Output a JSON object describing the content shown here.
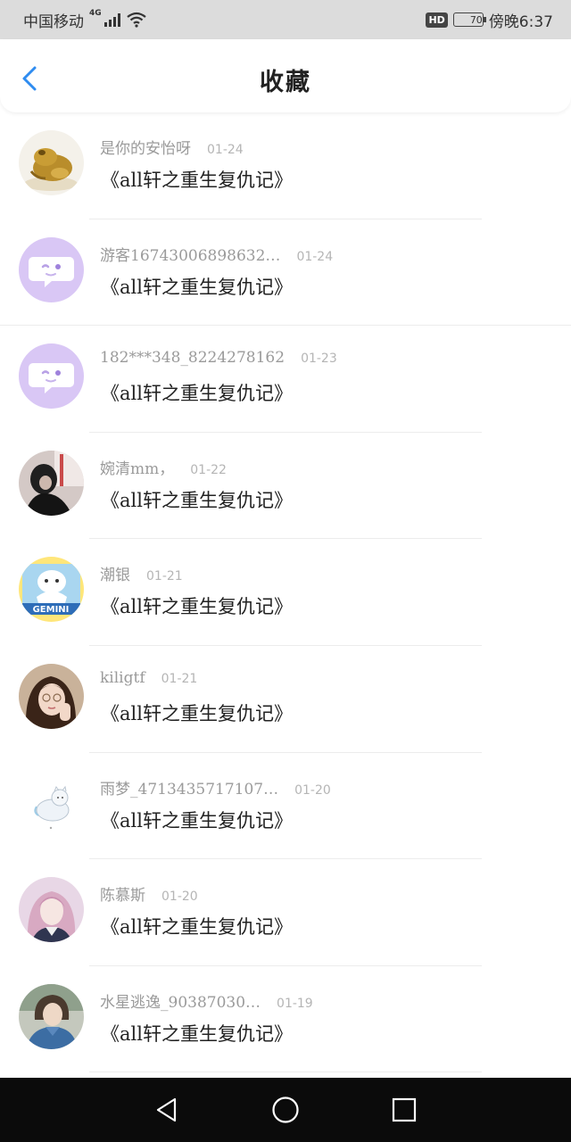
{
  "status_bar": {
    "carrier": "中国移动",
    "network": "4G",
    "battery": "70",
    "time": "傍晚6:37",
    "hd": "HD"
  },
  "header": {
    "title": "收藏",
    "back_icon": "chevron-left-icon"
  },
  "favorites": [
    {
      "user": "是你的安怡呀",
      "date": "01-24",
      "title": "《all轩之重生复仇记》",
      "avatar": "golden-toad"
    },
    {
      "user": "游客16743006898632…",
      "date": "01-24",
      "title": "《all轩之重生复仇记》",
      "avatar": "default-chat"
    },
    {
      "user": "182***348_8224278162",
      "date": "01-23",
      "title": "《all轩之重生复仇记》",
      "avatar": "default-chat"
    },
    {
      "user": "婉清mm，",
      "date": "01-22",
      "title": "《all轩之重生复仇记》",
      "avatar": "dark-portrait"
    },
    {
      "user": "潮银",
      "date": "01-21",
      "title": "《all轩之重生复仇记》",
      "avatar": "gemini-cartoon"
    },
    {
      "user": "kiligtf",
      "date": "01-21",
      "title": "《all轩之重生复仇记》",
      "avatar": "girl-portrait"
    },
    {
      "user": "雨梦_4713435717107…",
      "date": "01-20",
      "title": "《all轩之重生复仇记》",
      "avatar": "cat-sketch"
    },
    {
      "user": "陈慕斯",
      "date": "01-20",
      "title": "《all轩之重生复仇记》",
      "avatar": "pink-portrait"
    },
    {
      "user": "水星逃逸_90387030…",
      "date": "01-19",
      "title": "《all轩之重生复仇记》",
      "avatar": "blue-portrait"
    }
  ],
  "nav": {
    "back_icon": "triangle-back-icon",
    "home_icon": "circle-home-icon",
    "recent_icon": "square-recent-icon"
  },
  "colors": {
    "accent": "#2f8cf0",
    "default_avatar": "#d9c7f5",
    "nav_bar": "#0b0b0b",
    "status_bar": "#dcdcdc"
  }
}
